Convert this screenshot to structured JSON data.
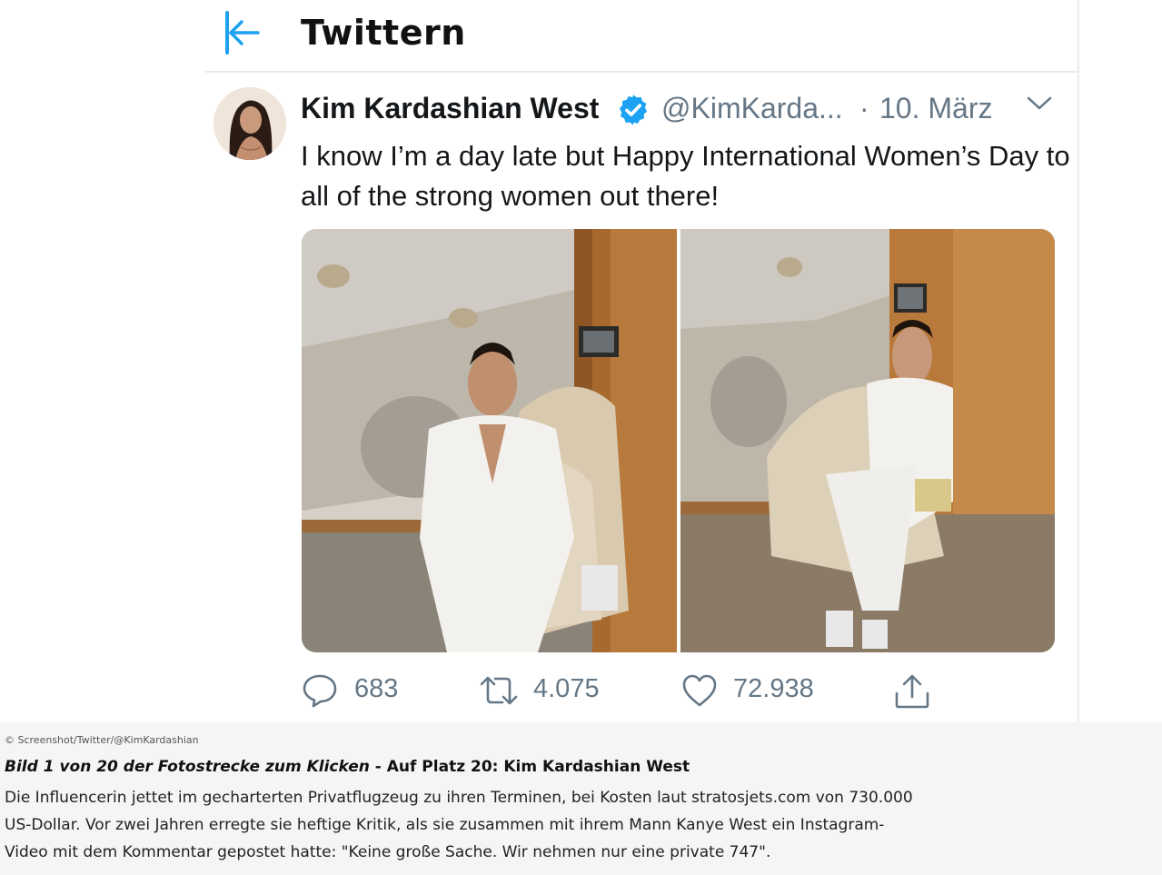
{
  "header": {
    "title": "Twittern",
    "back_icon": "back-arrow-icon",
    "accent_color": "#1da1f2"
  },
  "tweet": {
    "author_name": "Kim Kardashian West",
    "verified": true,
    "handle": "@KimKarda...",
    "separator": "·",
    "date": "10. März",
    "text": "I know I’m a day late but Happy International Women’s Day to all of the strong women out there!",
    "media_count": 2,
    "actions": {
      "reply_count": "683",
      "retweet_count": "4.075",
      "like_count": "72.938",
      "share_icon": "share-icon"
    }
  },
  "caption": {
    "credit": "© Screenshot/Twitter/@KimKardashian",
    "title_italic": "Bild 1 von 20 der Fotostrecke zum Klicken",
    "title_rest": " - Auf Platz 20: Kim Kardashian West",
    "body": "Die Influencerin jettet im gecharterten Privatflugzeug zu ihren Terminen, bei Kosten laut stratosjets.com von 730.000 US-Dollar. Vor zwei Jahren erregte sie heftige Kritik, als sie zusammen mit ihrem Mann Kanye West ein Instagram-Video mit dem Kommentar gepostet hatte: \"Keine große Sache. Wir nehmen nur eine private 747\"."
  }
}
